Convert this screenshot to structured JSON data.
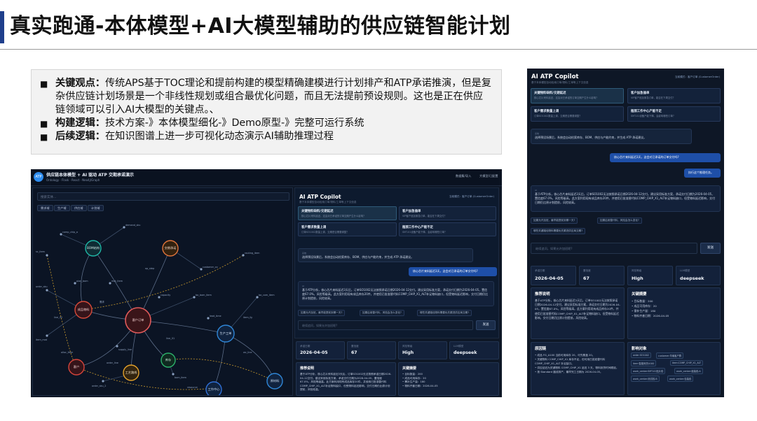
{
  "slide": {
    "title": "真实跑通-本体模型+AI大模型辅助的供应链智能计划",
    "bullet_symbol": "■",
    "points": [
      {
        "label": "关键观点：",
        "text": "传统APS基于TOC理论和提前构建的模型精确建模进行计划排产和ATP承诺推演，但是复杂供应链计划场景是一个非线性规划或组合最优化问题，而且无法提前预设规则。这也是正在供应链领域可以引入AI大模型的关键点。、"
      },
      {
        "label": "构建逻辑：",
        "text": "技术方案-》本体模型细化-》Demo原型-》完整可运行系统"
      },
      {
        "label": "后续逻辑：",
        "text": "在知识图谱上进一步可视化动态演示AI辅助推理过程"
      }
    ]
  },
  "app": {
    "logo": "ATP",
    "title": "供应链本体模型 + AI 驱动 ATP 交期承诺演示",
    "breadcrumb": "Ontology  ·  Flask  ·  React  ·  Neo4j/Graph",
    "top_actions": [
      "数据集/导入",
      "大模型/已配置"
    ],
    "graph": {
      "search_placeholder": "搜索实体...",
      "filters": [
        "需求域",
        "生产域",
        "供应域",
        "计划域"
      ],
      "legend_edge": "需求",
      "nodes": [
        {
          "label": "BOM结构",
          "color": "#1fb7a6"
        },
        {
          "label": "交期承诺",
          "color": "#e0753b"
        },
        {
          "label": "成品物料",
          "color": "#d64a3a"
        },
        {
          "label": "客户订单",
          "color": "#e05a5a"
        },
        {
          "label": "生产工单",
          "color": "#2f86d6"
        },
        {
          "label": "库存",
          "color": "#2db36b"
        },
        {
          "label": "客户",
          "color": "#d8453b"
        },
        {
          "label": "工艺路线",
          "color": "#e3a12a"
        },
        {
          "label": "工作中心",
          "color": "#2f6fd6"
        },
        {
          "label": "原材料",
          "color": "#2f86d6"
        }
      ],
      "minor_labels": [
        "comp_chip_a",
        "demand_sku",
        "customer_co",
        "ba_bom_item",
        "order_sku",
        "item_mat",
        "ba_com_item",
        "bom_item",
        "order_sku_2",
        "routing_item",
        "sc_item",
        "plan_bom",
        "mat_item",
        "supply_line",
        "lead_time",
        "capacity",
        "op_step",
        "line_01",
        "line_02",
        "order_line",
        "item_fg",
        "alloc_item",
        "resource",
        "wc_line"
      ]
    }
  },
  "copilot": {
    "title": "AI ATP Copilot",
    "subtitle": "基于本体模型自动检索订单/物料/工单等上下文信息",
    "mode": "当前模式：客户订单 (CustomerOrder)",
    "scenario_cards": [
      {
        "title": "关键物料缺料/交期延迟",
        "desc": "核心芯片来料延迟3天，这会对已承诺的订单交期产生什么影响？",
        "desc_short": "核心芯片来料延迟，这会对已承诺的订单交期产生什么影响？"
      },
      {
        "title": "客户加急插单",
        "desc": "VIP客户追加紧急订单50台，能否在下周交付？",
        "desc_short": "VIP客户追加紧急订单，能否在下周交付？"
      },
      {
        "title": "客户需求数量上调",
        "desc": "订单SO1002数量从200调整到300，交期是否需要调整？",
        "desc_short": "订单SO1002数量上调，交期是否需要调整？"
      },
      {
        "title": "瓶颈工作中心产能不足",
        "desc": "SMT-01设备产能降低，这会影响哪些订单的交付？",
        "desc_short": "SMT-01设备产能下降，会影响哪些订单？"
      }
    ],
    "system_tag": "系统",
    "system_msg": "选择预设场景后，系统会自动检索库存、BOM、供应与产能约束，并生成 ATP 承诺建议。",
    "user_msg": "核心芯片来料延迟3天，这会对已承诺的订单交付吗?",
    "user_msg_2": "执行这个推理任务。",
    "ai_tag": "AI",
    "ai_msg": "基于ATP分析，核心芯片来料延迟3天后，订单SO1002无法按照承诺日期2026-04-12交付。建议采用标准方案，承诺交付日期为2026-04-05，置信度67.0%，风险等级高。此方案利用现有成品库存20件，并使用已批准替代料COMP_CHIP_X1_ALT补足物料缺口，但受物料延迟影响，交付日期仍比原计划提前，风险较高。",
    "suggestions": [
      "如果允许加班，最早能提前到哪一天?",
      "如果启用替代料，风险会怎么变化?",
      "哪些关键路径物料需要优先跟进供应商交期?"
    ],
    "input_placeholder": "继续追问，如果允许加班呢?",
    "send_label": "发送",
    "kpis": [
      {
        "label": "承诺日期",
        "value": "2026-04-05"
      },
      {
        "label": "置信度",
        "value": "67"
      },
      {
        "label": "风险等级",
        "value": "High"
      },
      {
        "label": "LLM模型",
        "value": "deepseek"
      }
    ],
    "reco_title": "推荐说明",
    "reco_text": "基于ATP分析，核心芯片来料延迟3天后，订单SO1002无法按照承诺日期2026-04-12交付。建议采用标准方案，承诺交付日期为2026-04-05，置信度67.0%，风险等级高。此方案利用现有成品库存20件，并使用已批准替代料COMP_CHIP_X1_ALT补足物料缺口，但受物料延迟影响，交付日期仍比原计划提前，风险较高。",
    "summary_title": "关键摘要",
    "summary_items": [
      "目标数量：200",
      "成品可用库存：20",
      "需补生产量：180",
      "物料齐套日期：2026-04-05"
    ],
    "reasons_title": "原因链",
    "reasons": [
      "成品 FG_A100 当前可用库存 20，可先覆盖 20。",
      "关键物料 COMP_CHIP_X1 库存不足，但可用已批准替代料 COMP_CHIP_X1_ALT 补足缺口。",
      "供应延迟为关键物料 COMP_CHIP_X1 延迟 3 天，物料到货时间顺延。",
      "按 Standard 路线排产，最早完工日期为 2026-04-05。"
    ],
    "impact_title": "影响对象",
    "impact_tags": [
      "order:SO1002",
      "customer:华南客户群",
      "item:智能网关A100",
      "item:COMP_CHIP_X1_ALT",
      "work_center:SMT-01贴片线",
      "work_center:组装线-A",
      "work_center:测试线-B",
      "work_center:包装线"
    ]
  },
  "colors": {
    "accent": "#1f3f8c",
    "dark_bg": "#0e1726",
    "user_bubble": "#1e4fa8"
  }
}
